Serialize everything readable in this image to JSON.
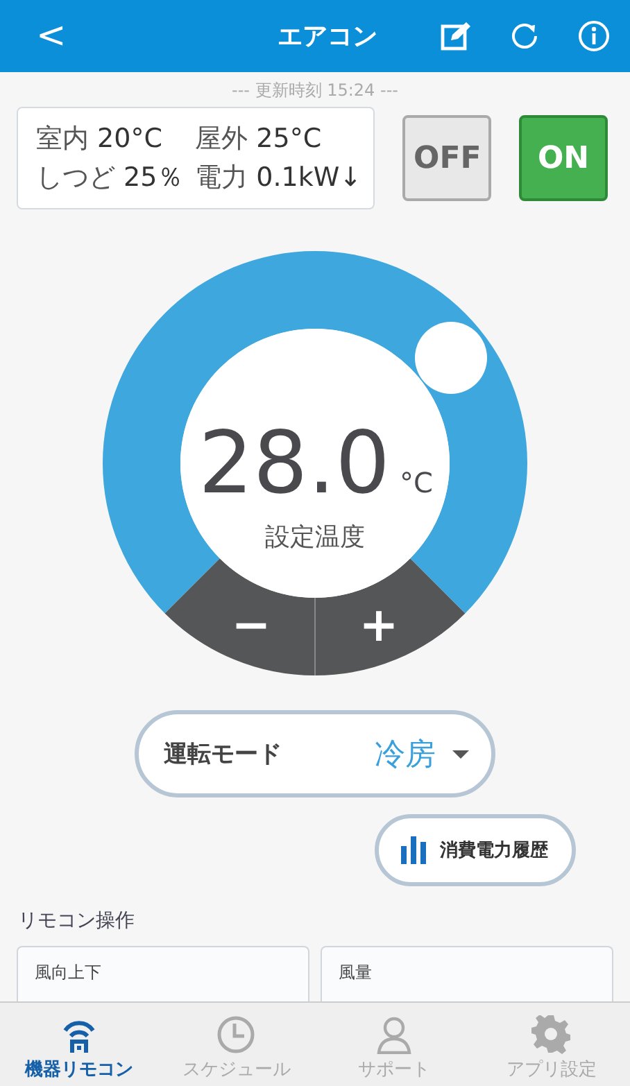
{
  "header": {
    "back": "<",
    "title": "エアコン"
  },
  "updated": "--- 更新時刻 15:24 ---",
  "readings": [
    {
      "label": "室内",
      "value": "20°C"
    },
    {
      "label": "屋外",
      "value": "25°C"
    },
    {
      "label": "しつど",
      "value": "25％"
    },
    {
      "label": "電力",
      "value": "0.1kW↓"
    }
  ],
  "power": [
    {
      "label": "OFF",
      "selected": false
    },
    {
      "label": "ON",
      "selected": true
    }
  ],
  "dial": {
    "temperature": "28.0",
    "unit": "°C",
    "caption": "設定温度",
    "minus": "−",
    "plus": "+"
  },
  "mode": {
    "label": "運転モード",
    "value": "冷房"
  },
  "history_button": "消費電力履歴",
  "section_title": "リモコン操作",
  "cards": [
    {
      "title": "風向上下"
    },
    {
      "title": "風量"
    }
  ],
  "tabs": [
    {
      "label": "機器リモコン",
      "kind": "remote",
      "selected": true
    },
    {
      "label": "スケジュール",
      "kind": "clock",
      "selected": false
    },
    {
      "label": "サポート",
      "kind": "person",
      "selected": false
    },
    {
      "label": "アプリ設定",
      "kind": "gear",
      "selected": false
    }
  ]
}
